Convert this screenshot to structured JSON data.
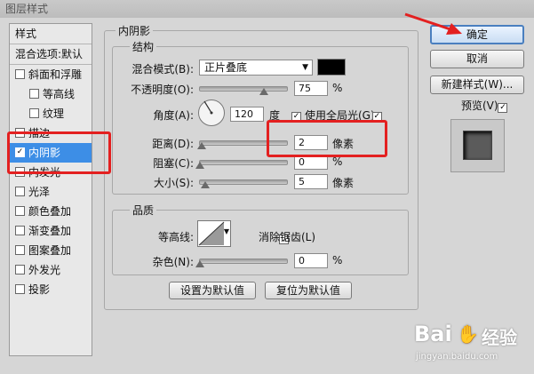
{
  "window": {
    "title": "图层样式"
  },
  "sidebar": {
    "header": "样式",
    "items": [
      {
        "label": "混合选项:默认",
        "checkbox": false,
        "checked": false,
        "sub": false,
        "selected": false
      },
      {
        "label": "斜面和浮雕",
        "checkbox": true,
        "checked": false,
        "sub": false,
        "selected": false
      },
      {
        "label": "等高线",
        "checkbox": true,
        "checked": false,
        "sub": true,
        "selected": false
      },
      {
        "label": "纹理",
        "checkbox": true,
        "checked": false,
        "sub": true,
        "selected": false
      },
      {
        "label": "描边",
        "checkbox": true,
        "checked": false,
        "sub": false,
        "selected": false
      },
      {
        "label": "内阴影",
        "checkbox": true,
        "checked": true,
        "sub": false,
        "selected": true
      },
      {
        "label": "内发光",
        "checkbox": true,
        "checked": false,
        "sub": false,
        "selected": false
      },
      {
        "label": "光泽",
        "checkbox": true,
        "checked": false,
        "sub": false,
        "selected": false
      },
      {
        "label": "颜色叠加",
        "checkbox": true,
        "checked": false,
        "sub": false,
        "selected": false
      },
      {
        "label": "渐变叠加",
        "checkbox": true,
        "checked": false,
        "sub": false,
        "selected": false
      },
      {
        "label": "图案叠加",
        "checkbox": true,
        "checked": false,
        "sub": false,
        "selected": false
      },
      {
        "label": "外发光",
        "checkbox": true,
        "checked": false,
        "sub": false,
        "selected": false
      },
      {
        "label": "投影",
        "checkbox": true,
        "checked": false,
        "sub": false,
        "selected": false
      }
    ]
  },
  "panel": {
    "title": "内阴影",
    "structure": {
      "title": "结构",
      "blend_mode_label": "混合模式(B):",
      "blend_mode_value": "正片叠底",
      "blend_color": "#000000",
      "opacity_label": "不透明度(O):",
      "opacity_value": "75",
      "opacity_unit": "%",
      "angle_label": "角度(A):",
      "angle_value": "120",
      "angle_unit": "度",
      "global_light_label": "使用全局光(G)",
      "global_light_checked": true,
      "distance_label": "距离(D):",
      "distance_value": "2",
      "distance_unit": "像素",
      "choke_label": "阻塞(C):",
      "choke_value": "0",
      "choke_unit": "%",
      "size_label": "大小(S):",
      "size_value": "5",
      "size_unit": "像素"
    },
    "quality": {
      "title": "品质",
      "contour_label": "等高线:",
      "antialias_label": "消除锯齿(L)",
      "antialias_checked": false,
      "noise_label": "杂色(N):",
      "noise_value": "0",
      "noise_unit": "%"
    },
    "buttons": {
      "make_default": "设置为默认值",
      "reset_default": "复位为默认值"
    }
  },
  "right": {
    "ok": "确定",
    "cancel": "取消",
    "new_style": "新建样式(W)...",
    "preview_label": "预览(V)",
    "preview_checked": true
  },
  "watermark": {
    "text_baidu": "Bai",
    "text_jingyan": "经验",
    "url": "jingyan.baidu.com"
  },
  "colors": {
    "annotation": "#e32020",
    "selected": "#3d8ee6",
    "arrow": "#e32020"
  }
}
